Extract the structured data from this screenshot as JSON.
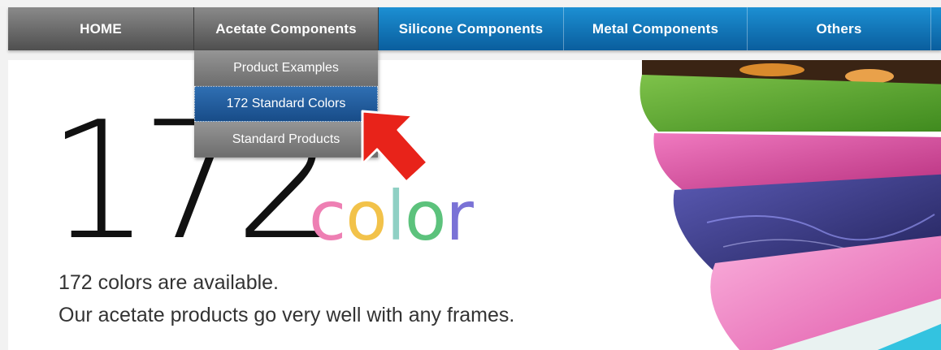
{
  "nav": {
    "items": [
      {
        "label": "HOME"
      },
      {
        "label": "Acetate Components"
      },
      {
        "label": "Silicone Components"
      },
      {
        "label": "Metal Components"
      },
      {
        "label": "Others"
      }
    ]
  },
  "dropdown": {
    "items": [
      {
        "label": "Product Examples"
      },
      {
        "label": "172 Standard Colors"
      },
      {
        "label": "Standard Products"
      }
    ]
  },
  "hero": {
    "big_number": "172",
    "color_word": {
      "letters": [
        {
          "char": "c",
          "color": "#ee7fb3"
        },
        {
          "char": "o",
          "color": "#f2c24a"
        },
        {
          "char": "l",
          "color": "#8fd0c4"
        },
        {
          "char": "o",
          "color": "#5cc27c"
        },
        {
          "char": "r",
          "color": "#7a72d6"
        }
      ]
    },
    "description_1": "172 colors are available.",
    "description_2": "Our acetate products go very well with any frames."
  },
  "colors": {
    "nav_grey": "#6b6b6b",
    "nav_blue": "#0f72b7",
    "dropdown_active": "#245f9f",
    "arrow": "#e8231a"
  }
}
